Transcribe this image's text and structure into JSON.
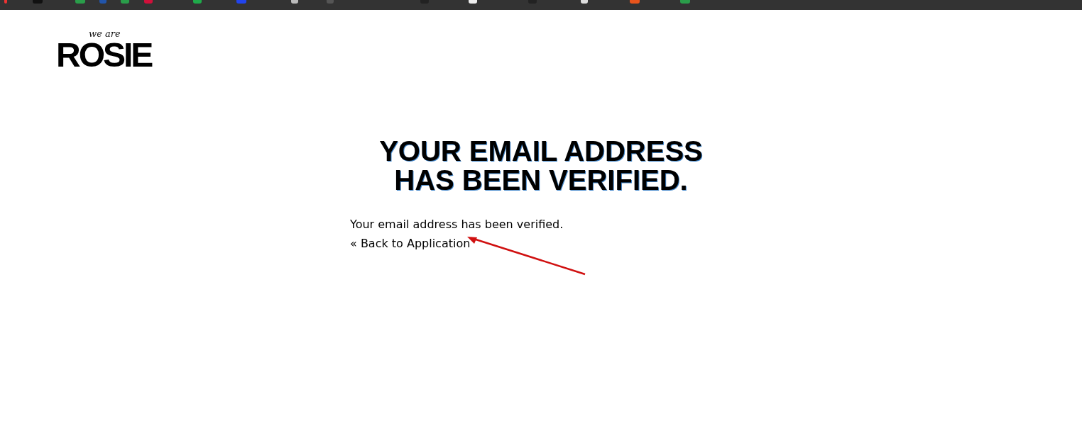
{
  "logo": {
    "tagline": "we are",
    "name": "ROSIE"
  },
  "heading": {
    "lines": [
      "YOUR EMAIL ADDRESS",
      "HAS BEEN VERIFIED."
    ]
  },
  "message": "Your email address has been verified.",
  "back_link": {
    "icon": "«",
    "label": "Back to Application"
  }
}
